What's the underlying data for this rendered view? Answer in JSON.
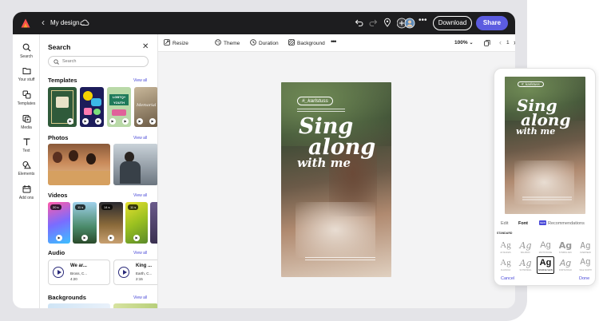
{
  "topbar": {
    "title": "My design...",
    "download_label": "Download",
    "share_label": "Share",
    "accent": "#5c5ce0"
  },
  "rail": {
    "items": [
      {
        "label": "Search",
        "icon": "search-icon"
      },
      {
        "label": "Your stuff",
        "icon": "folder-icon"
      },
      {
        "label": "Templates",
        "icon": "templates-icon"
      },
      {
        "label": "Media",
        "icon": "media-icon"
      },
      {
        "label": "Text",
        "icon": "text-icon"
      },
      {
        "label": "Elements",
        "icon": "shapes-icon"
      },
      {
        "label": "Add ons",
        "icon": "add-ons-icon"
      }
    ]
  },
  "panel": {
    "title": "Search",
    "search_placeholder": "Search",
    "view_all": "View all",
    "sections": {
      "templates": "Templates",
      "photos": "Photos",
      "videos": "Videos",
      "audio": "Audio",
      "backgrounds": "Backgrounds"
    },
    "template_text": {
      "lgbtq": "LGBTQ+ YOUTH",
      "memorial": "Memorial"
    },
    "video_durations": [
      "20 s",
      "11 s",
      "14 s",
      "11 s"
    ],
    "audio": [
      {
        "title": "We ar...",
        "artist": "Bross, C...",
        "duration": "4:20"
      },
      {
        "title": "King ...",
        "artist": "Earth, C...",
        "duration": "2:15"
      }
    ]
  },
  "toolbar": {
    "resize": "Resize",
    "theme": "Theme",
    "duration": "Duration",
    "background": "Background",
    "zoom": "100%",
    "page": "1"
  },
  "design": {
    "hashtag": "#_karlstuss",
    "headline": [
      "Sing",
      "along",
      "with me"
    ]
  },
  "phone": {
    "hashtag": "#_karlstuss",
    "tabs": {
      "edit": "Edit",
      "font": "Font",
      "recommendations": "Recommendations",
      "badge": "NEW"
    },
    "section": "STANDARD",
    "swatch_glyph": "Ag",
    "fonts": [
      "AF MADIAS",
      "BALDWAY",
      "MINTSTROKE",
      "SYMBOL ARC",
      "OVERHEAD",
      "CLASSICA",
      "SCHWINDAL",
      "SOURCE SANS",
      "FORTE BOLD",
      "TALE NORTH"
    ],
    "cancel": "Cancel",
    "done": "Done"
  }
}
